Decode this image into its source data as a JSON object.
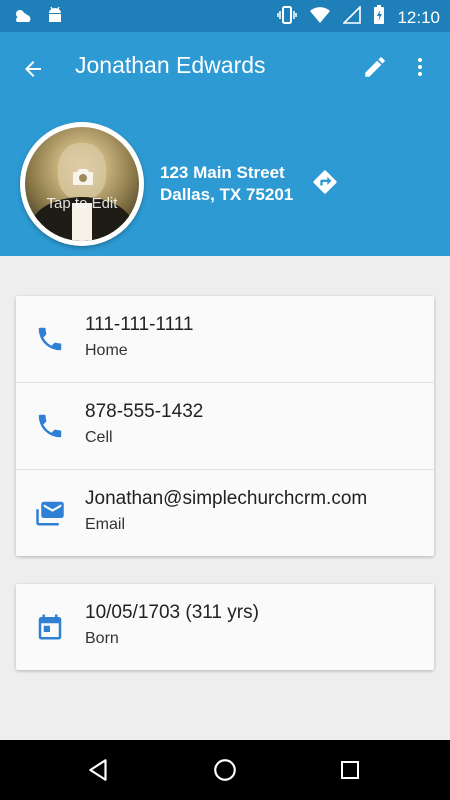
{
  "status_bar": {
    "time": "12:10",
    "left_icons": [
      "weather-icon",
      "android-icon"
    ],
    "right_icons": [
      "vibrate-icon",
      "wifi-icon",
      "signal-icon",
      "battery-icon"
    ]
  },
  "app_bar": {
    "title": "Jonathan Edwards"
  },
  "header": {
    "tap_to_edit": "Tap to Edit",
    "address_line1": "123 Main Street",
    "address_line2": "Dallas, TX 75201"
  },
  "contact_rows": [
    {
      "value": "111-111-1111",
      "label": "Home",
      "icon": "phone-icon"
    },
    {
      "value": "878-555-1432",
      "label": "Cell",
      "icon": "phone-icon"
    },
    {
      "value": "Jonathan@simplechurchcrm.com",
      "label": "Email",
      "icon": "email-icon"
    }
  ],
  "birth": {
    "value": "10/05/1703 (311 yrs)",
    "label": "Born",
    "icon": "calendar-icon"
  },
  "colors": {
    "primary": "#2d9ad3",
    "primary_dark": "#1f7fb8",
    "icon_accent": "#2f80d4",
    "background": "#eeeeee"
  }
}
